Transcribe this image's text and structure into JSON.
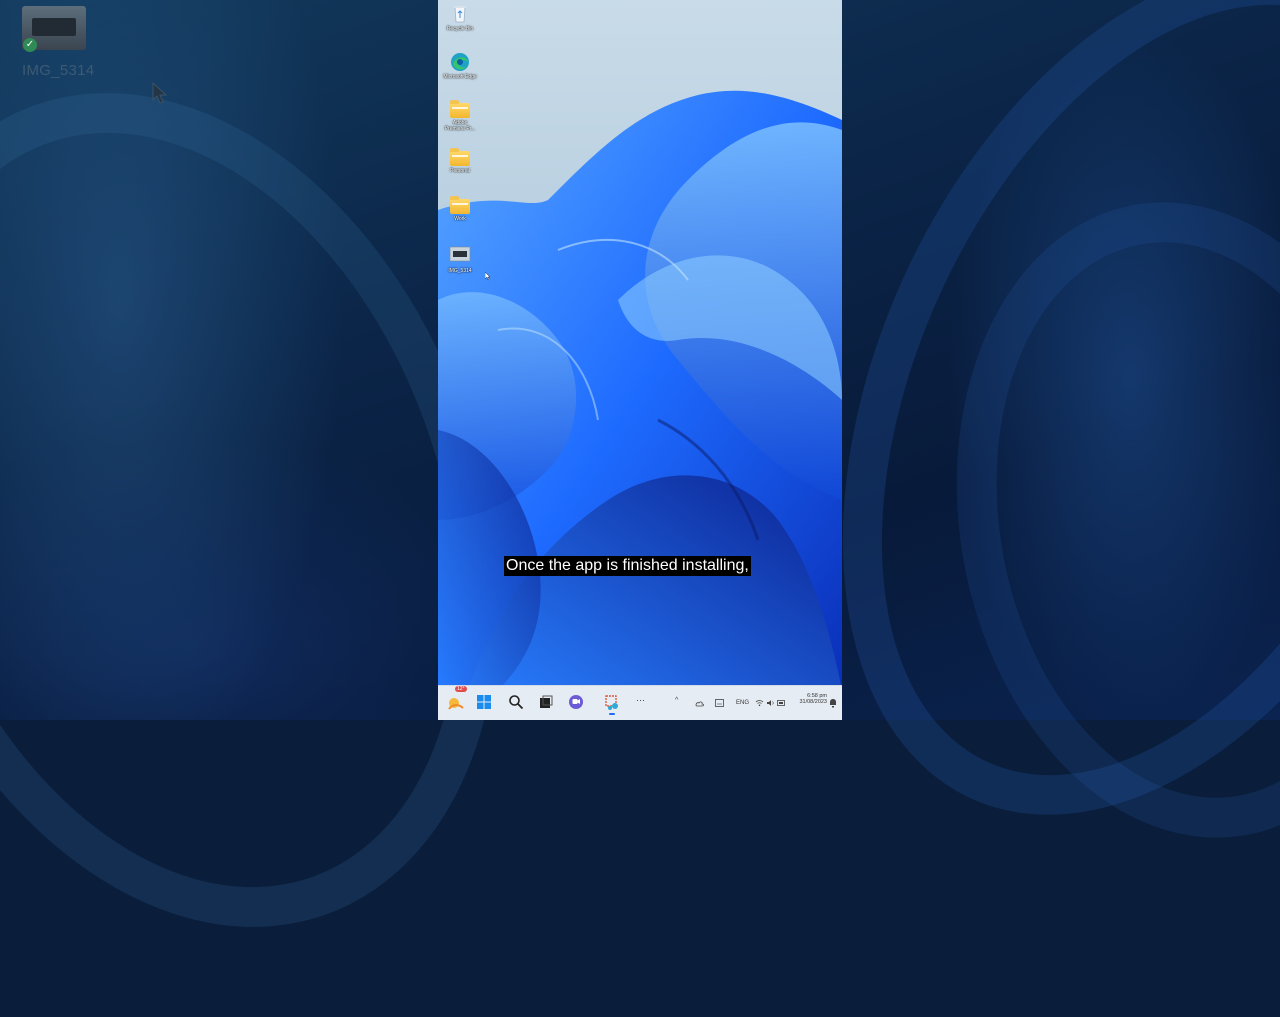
{
  "ghost_icon": {
    "label": "IMG_5314",
    "check": "✓"
  },
  "desktop_icons": [
    {
      "name": "recycle-bin-icon",
      "label": "Recycle Bin"
    },
    {
      "name": "edge-icon",
      "label": "Microsoft Edge"
    },
    {
      "name": "folder-icon",
      "label": "Adobe Premiere Pr..."
    },
    {
      "name": "folder-icon",
      "label": "Personal"
    },
    {
      "name": "folder-icon",
      "label": "Work"
    },
    {
      "name": "image-icon",
      "label": "IMG_5314"
    }
  ],
  "subtitle": "Once the app is finished installing,",
  "taskbar": {
    "weather_temp": "12°",
    "language": "ENG",
    "time": "6:58 pm",
    "date": "31/08/2023",
    "overflow": "···",
    "chevron": "^"
  },
  "colors": {
    "accent": "#1e6bff",
    "taskbar": "#e6ecf3"
  }
}
